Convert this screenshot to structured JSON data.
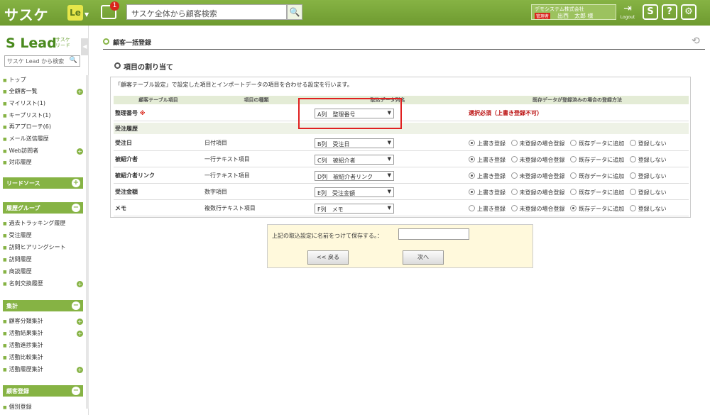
{
  "header": {
    "logo": "サスケ",
    "le_label": "Le",
    "notification_count": "1",
    "search_placeholder": "サスケ全体から顧客検索",
    "company": "デモシステム株式会社",
    "role": "管理者",
    "user": "出西　太郎 様",
    "logout": "Logout",
    "btn_s": "S",
    "btn_help": "?",
    "btn_settings": "⚙"
  },
  "sidebar": {
    "logo": "Lead",
    "logo_sub1": "サスケ",
    "logo_sub2": "リード",
    "search_placeholder": "サスケ Lead から検索",
    "items": [
      "トップ",
      "全顧客一覧",
      "マイリスト(1)",
      "キープリスト(1)",
      "再アプローチ(6)",
      "メール送信履歴",
      "Web訪問者",
      "対応履歴"
    ],
    "lead_source": "リードソース",
    "history_group": "履歴グループ",
    "history_items": [
      "過去トラッキング履歴",
      "受注履歴",
      "訪問ヒアリングシート",
      "訪問履歴",
      "商談履歴",
      "名刺交換履歴"
    ],
    "aggregate": "集計",
    "aggregate_items": [
      "顧客分類集計",
      "活動結果集計",
      "活動進捗集計",
      "活動比較集計",
      "活動履歴集計"
    ],
    "customer_reg": "顧客登録",
    "customer_reg_items": [
      "個別登録"
    ]
  },
  "main": {
    "page_title": "顧客一括登録",
    "section_title": "項目の割り当て",
    "description": "「顧客テーブル設定」で設定した項目とインポートデータの項目を合わせる設定を行います。",
    "headers": [
      "顧客テーブル項目",
      "項目の種類",
      "取込データ列名",
      "既存データが登録済みの場合の登録方法"
    ],
    "row0": {
      "label": "整理番号",
      "required": "※",
      "select": "A列　整理番号",
      "message": "選択必須（上書き登録不可）"
    },
    "group": "受注履歴",
    "rows": [
      {
        "label": "受注日",
        "type": "日付項目",
        "select": "B列　受注日"
      },
      {
        "label": "被紹介者",
        "type": "一行テキスト項目",
        "select": "C列　被紹介者"
      },
      {
        "label": "被紹介者リンク",
        "type": "一行テキスト項目",
        "select": "D列　被紹介者リンク"
      },
      {
        "label": "受注金額",
        "type": "数字項目",
        "select": "E列　受注金額"
      },
      {
        "label": "メモ",
        "type": "複数行テキスト項目",
        "select": "F列　メモ"
      }
    ],
    "radio_options": [
      "上書き登録",
      "未登録の場合登録",
      "既存データに追加",
      "登録しない"
    ],
    "save_label": "上記の取込設定に名前をつけて保存する。：",
    "back_button": "<< 戻る",
    "next_button": "次へ"
  }
}
